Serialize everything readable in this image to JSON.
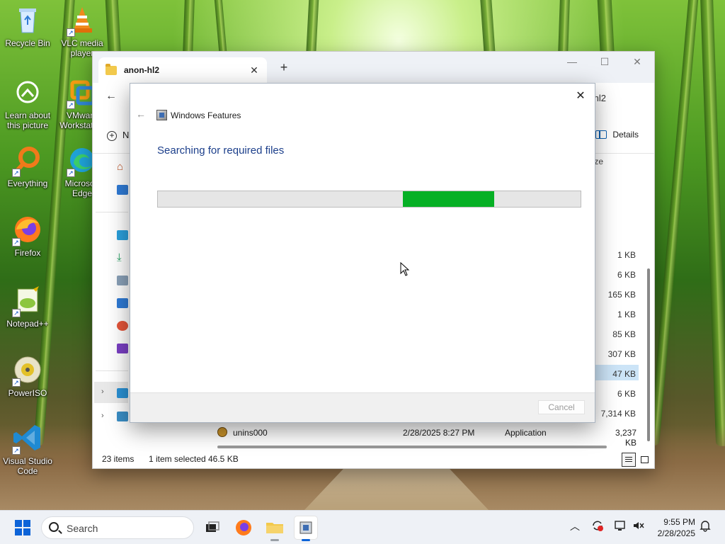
{
  "desktop": {
    "icons": [
      {
        "label": "Recycle Bin"
      },
      {
        "label": "VLC media player"
      },
      {
        "label": "Learn about this picture"
      },
      {
        "label": "VMware Workstation"
      },
      {
        "label": "Everything"
      },
      {
        "label": "Microsoft Edge"
      },
      {
        "label": "Firefox"
      },
      {
        "label": "Notepad++"
      },
      {
        "label": "PowerISO"
      },
      {
        "label": "Visual Studio Code"
      }
    ]
  },
  "explorer": {
    "tab_title": "anon-hl2",
    "tab_close": "✕",
    "new_tab": "+",
    "address_fragment": "hl2",
    "new_label": "N",
    "details_label": "Details",
    "size_header": "ze",
    "sizes": [
      "1 KB",
      "6 KB",
      "165 KB",
      "1 KB",
      "85 KB",
      "307 KB",
      "47 KB",
      "6 KB",
      "7,314 KB"
    ],
    "selected_size_index": 6,
    "file_row": {
      "name": "unins000",
      "date": "2/28/2025 8:27 PM",
      "type": "Application",
      "size": "3,237 KB"
    },
    "status": {
      "items": "23 items",
      "selected": "1 item selected",
      "selected_size": "46.5 KB"
    }
  },
  "dialog": {
    "title": "Windows Features",
    "heading": "Searching for required files",
    "progress": {
      "segment_start_fraction": 0.58,
      "segment_end_fraction": 0.795
    },
    "cancel_label": "Cancel"
  },
  "taskbar": {
    "search_placeholder": "Search",
    "clock_time": "9:55 PM",
    "clock_date": "2/28/2025"
  },
  "colors": {
    "progress_fill": "#06b025",
    "heading": "#1c3f8b",
    "accent": "#0c63d8"
  }
}
